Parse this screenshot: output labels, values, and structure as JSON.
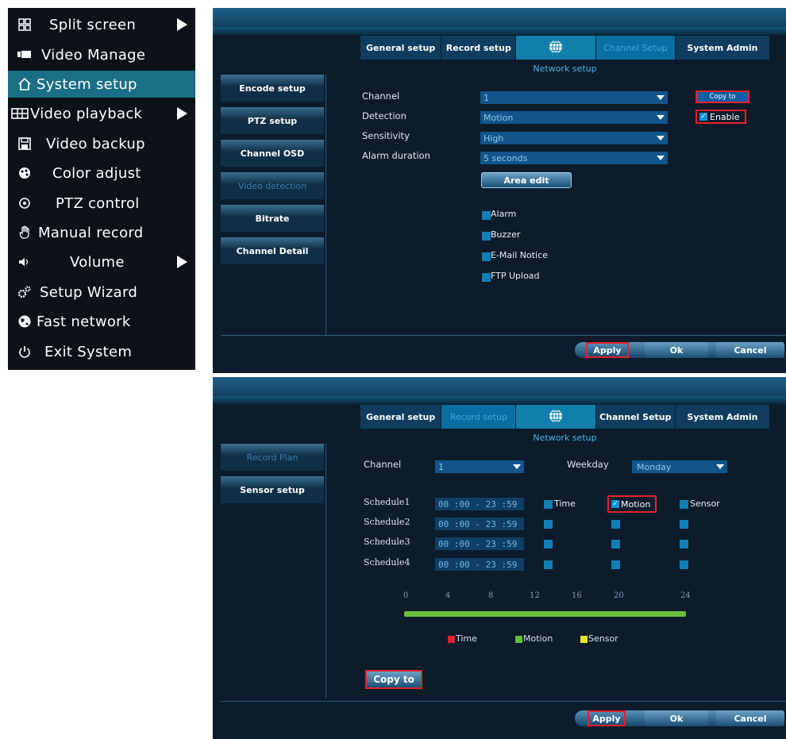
{
  "menu": {
    "items": [
      {
        "label": "Split screen",
        "icon": "split-screen-icon",
        "submenu": true
      },
      {
        "label": "Video Manage",
        "icon": "camera-icon",
        "submenu": false
      },
      {
        "label": "System setup",
        "icon": "home-icon",
        "submenu": false,
        "active": true
      },
      {
        "label": "Video playback",
        "icon": "film-icon",
        "submenu": true
      },
      {
        "label": "Video backup",
        "icon": "floppy-icon",
        "submenu": false
      },
      {
        "label": "Color adjust",
        "icon": "palette-icon",
        "submenu": false
      },
      {
        "label": "PTZ control",
        "icon": "ptz-icon",
        "submenu": false
      },
      {
        "label": "Manual record",
        "icon": "hand-icon",
        "submenu": false
      },
      {
        "label": "Volume",
        "icon": "speaker-icon",
        "submenu": true
      },
      {
        "label": "Setup Wizard",
        "icon": "gears-icon",
        "submenu": false
      },
      {
        "label": "Fast network",
        "icon": "globe-icon",
        "submenu": false
      },
      {
        "label": "Exit System",
        "icon": "power-icon",
        "submenu": false
      }
    ]
  },
  "tabs": {
    "general": "General setup",
    "record": "Record setup",
    "channel": "Channel Setup",
    "system": "System Admin"
  },
  "subtitle": "Network setup",
  "top": {
    "sidebar": [
      "Encode setup",
      "PTZ setup",
      "Channel OSD",
      "Video detection",
      "Bitrate",
      "Channel Detail"
    ],
    "active_sidebar": "Video detection",
    "fields": {
      "channel_label": "Channel",
      "channel_value": "1",
      "detection_label": "Detection",
      "detection_value": "Motion",
      "sensitivity_label": "Sensitivity",
      "sensitivity_value": "High",
      "alarm_label": "Alarm duration",
      "alarm_value": "5 seconds"
    },
    "area_edit": "Area edit",
    "copy_to": "Copy to",
    "enable": "Enable",
    "checks": [
      "Alarm",
      "Buzzer",
      "E-Mail Notice",
      "FTP Upload"
    ],
    "apply": "Apply",
    "ok": "Ok",
    "cancel": "Cancel"
  },
  "bottom": {
    "sidebar": [
      "Record Plan",
      "Sensor setup"
    ],
    "active_sidebar": "Record Plan",
    "channel_label": "Channel",
    "channel_value": "1",
    "weekday_label": "Weekday",
    "weekday_value": "Monday",
    "schedules": [
      {
        "label": "Schedule1",
        "time": "00 :00 - 23 :59"
      },
      {
        "label": "Schedule2",
        "time": "00 :00 - 23 :59"
      },
      {
        "label": "Schedule3",
        "time": "00 :00 - 23 :59"
      },
      {
        "label": "Schedule4",
        "time": "00 :00 - 23 :59"
      }
    ],
    "col_time": "Time",
    "col_motion": "Motion",
    "col_sensor": "Sensor",
    "ticks": [
      "0",
      "4",
      "8",
      "12",
      "16",
      "20",
      "24"
    ],
    "legend": [
      {
        "label": "Time",
        "color": "#e4222a"
      },
      {
        "label": "Motion",
        "color": "#5fbf3a"
      },
      {
        "label": "Sensor",
        "color": "#efe21f"
      }
    ],
    "copy_to": "Copy to",
    "apply": "Apply",
    "ok": "Ok",
    "cancel": "Cancel"
  }
}
